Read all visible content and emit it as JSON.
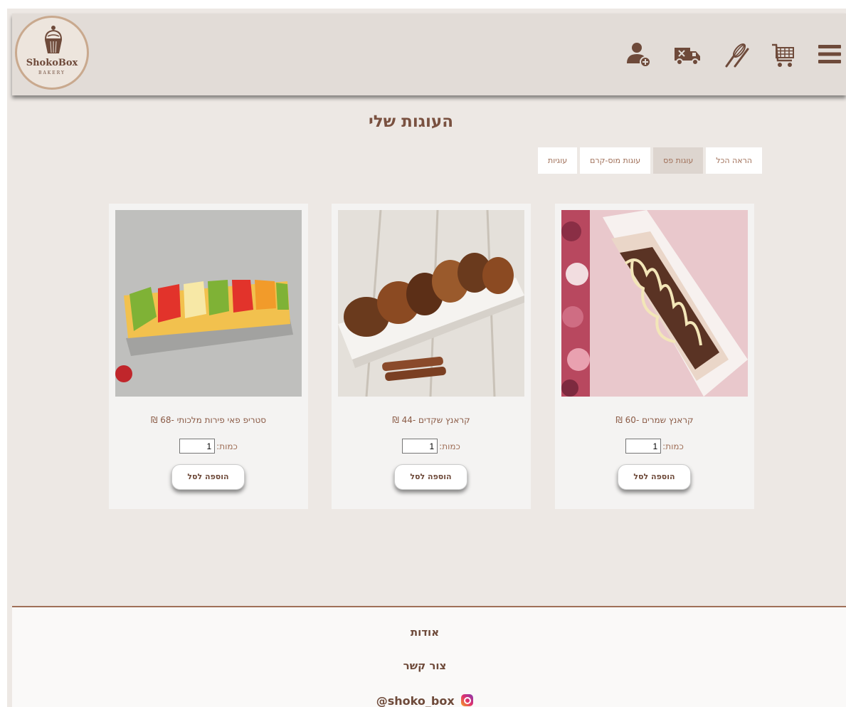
{
  "header": {
    "logo_name": "ShokoBox",
    "logo_sub": "BAKERY",
    "icons": [
      "add-user-icon",
      "delivery-truck-icon",
      "whisk-icon",
      "shopping-cart-icon",
      "hamburger-menu-icon"
    ]
  },
  "page_title": "העוגות שלי",
  "filters": [
    {
      "label": "הראה הכל",
      "active": false
    },
    {
      "label": "עוגות פס",
      "active": true
    },
    {
      "label": "עוגות מוס-קרם",
      "active": false
    },
    {
      "label": "עוגיות",
      "active": false
    }
  ],
  "products": [
    {
      "name": "קראנץ שמרים -60 ₪",
      "qty_label": "כמות:",
      "qty": "1",
      "button": "הוספה לסל"
    },
    {
      "name": "קראנץ שקדים -44 ₪",
      "qty_label": "כמות:",
      "qty": "1",
      "button": "הוספה לסל"
    },
    {
      "name": "סטריפ פאי פירות מלכותי -68 ₪",
      "qty_label": "כמות:",
      "qty": "1",
      "button": "הוספה לסל"
    }
  ],
  "footer": {
    "about": "אודות",
    "contact": "צור קשר",
    "instagram": "@shoko_box"
  },
  "colors": {
    "brand_brown": "#6e4a3a",
    "accent": "#a07059",
    "page_bg": "#ede8e4",
    "header_bg": "#e2dcd7"
  }
}
